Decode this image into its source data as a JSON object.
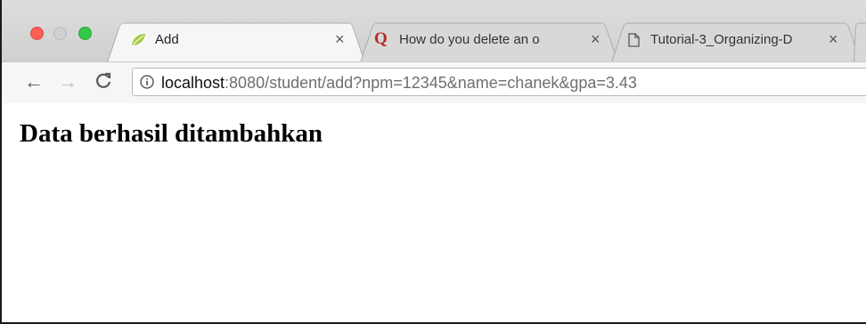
{
  "window": {
    "traffic_lights": [
      "close",
      "minimize",
      "maximize"
    ]
  },
  "tabs": [
    {
      "title": "Add",
      "active": true,
      "icon": "spring-leaf-icon",
      "close_glyph": "×"
    },
    {
      "title": "How do you delete an o",
      "active": false,
      "icon": "quora-icon",
      "icon_glyph": "Q",
      "close_glyph": "×"
    },
    {
      "title": "Tutorial-3_Organizing-D",
      "active": false,
      "icon": "document-icon",
      "close_glyph": "×"
    }
  ],
  "toolbar": {
    "back_glyph": "←",
    "forward_glyph": "→",
    "reload_glyph": "C",
    "url_host": "localhost",
    "url_rest": ":8080/student/add?npm=12345&name=chanek&gpa=3.43"
  },
  "page": {
    "heading": "Data berhasil ditambahkan"
  },
  "colors": {
    "close": "#fc5f57",
    "maximize": "#34c749",
    "quora": "#b92b27",
    "spring": "#6db33f"
  }
}
